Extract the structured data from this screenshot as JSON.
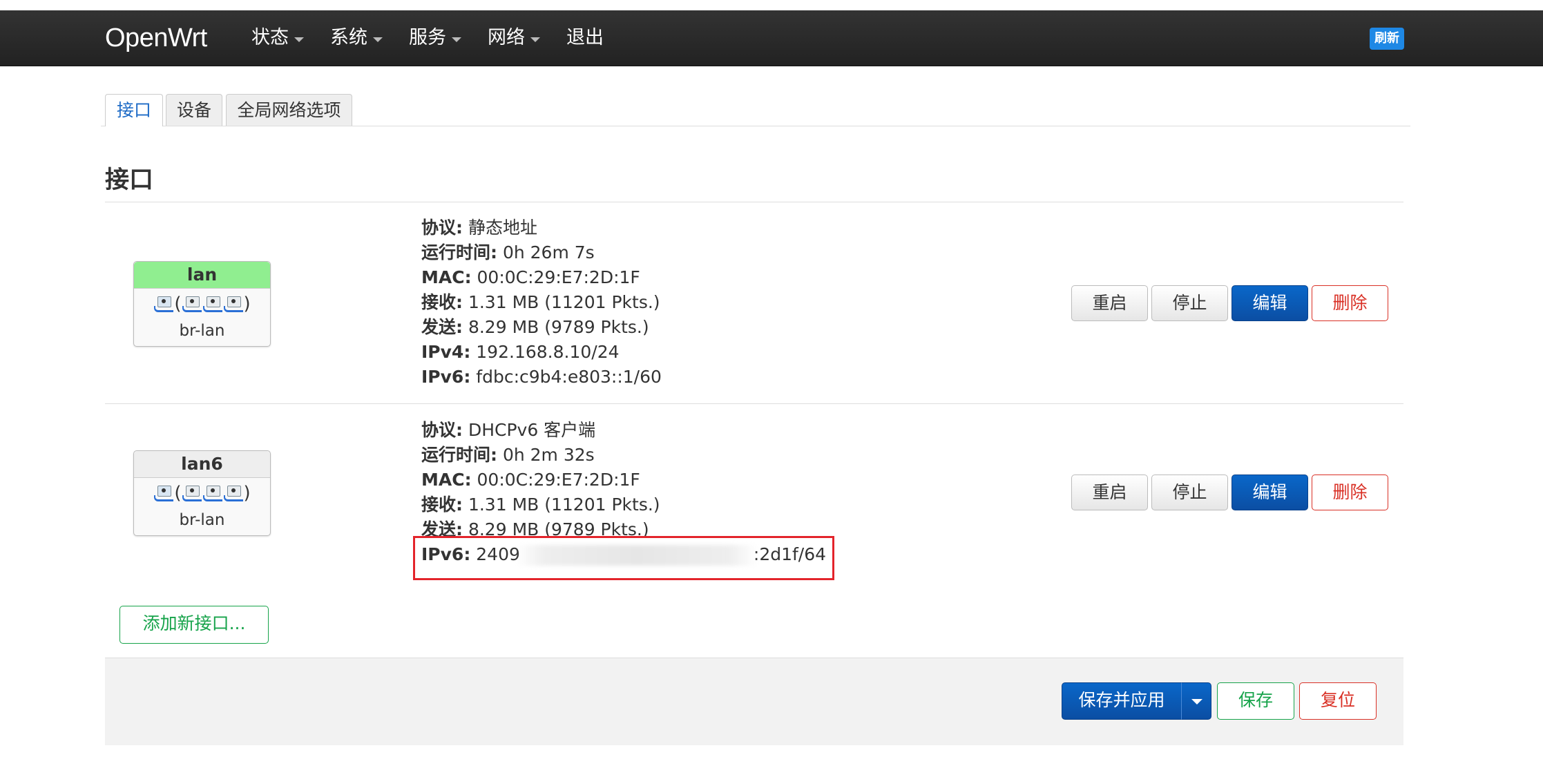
{
  "header": {
    "brand": "OpenWrt",
    "menu": [
      {
        "label": "状态",
        "has_caret": true
      },
      {
        "label": "系统",
        "has_caret": true
      },
      {
        "label": "服务",
        "has_caret": true
      },
      {
        "label": "网络",
        "has_caret": true
      },
      {
        "label": "退出",
        "has_caret": false
      }
    ],
    "refresh_label": "刷新"
  },
  "tabs": [
    {
      "label": "接口",
      "active": true
    },
    {
      "label": "设备",
      "active": false
    },
    {
      "label": "全局网络选项",
      "active": false
    }
  ],
  "page_title": "接口",
  "interfaces": [
    {
      "name": "lan",
      "device": "br-lan",
      "name_bg": "#90ee90",
      "details": {
        "protocol": {
          "label": "协议:",
          "value": "静态地址"
        },
        "uptime": {
          "label": "运行时间:",
          "value": "0h 26m 7s"
        },
        "mac": {
          "label": "MAC:",
          "value": "00:0C:29:E7:2D:1F"
        },
        "rx": {
          "label": "接收:",
          "value": "1.31 MB (11201 Pkts.)"
        },
        "tx": {
          "label": "发送:",
          "value": "8.29 MB (9789 Pkts.)"
        },
        "ipv4": {
          "label": "IPv4:",
          "value": "192.168.8.10/24"
        },
        "ipv6": {
          "label": "IPv6:",
          "value": "fdbc:c9b4:e803::1/60"
        }
      },
      "buttons": {
        "restart": "重启",
        "stop": "停止",
        "edit": "编辑",
        "delete": "删除"
      }
    },
    {
      "name": "lan6",
      "device": "br-lan",
      "name_bg": "#eeeeee",
      "details": {
        "protocol": {
          "label": "协议:",
          "value": "DHCPv6 客户端"
        },
        "uptime": {
          "label": "运行时间:",
          "value": "0h 2m 32s"
        },
        "mac": {
          "label": "MAC:",
          "value": "00:0C:29:E7:2D:1F"
        },
        "rx": {
          "label": "接收:",
          "value": "1.31 MB (11201 Pkts.)"
        },
        "tx": {
          "label": "发送:",
          "value": "8.29 MB (9789 Pkts.)"
        },
        "ipv6": {
          "label": "IPv6:",
          "value_prefix": "2409",
          "value_suffix": ":2d1f/64"
        }
      },
      "buttons": {
        "restart": "重启",
        "stop": "停止",
        "edit": "编辑",
        "delete": "删除"
      }
    }
  ],
  "add_interface_label": "添加新接口...",
  "footer": {
    "save_apply": "保存并应用",
    "save": "保存",
    "reset": "复位"
  },
  "colors": {
    "topbar": "#222222",
    "primary": "#0b5cb8",
    "danger": "#d93025",
    "success": "#16a34a",
    "highlight": "#e3242b",
    "active_tab": "#1e6bc6"
  }
}
